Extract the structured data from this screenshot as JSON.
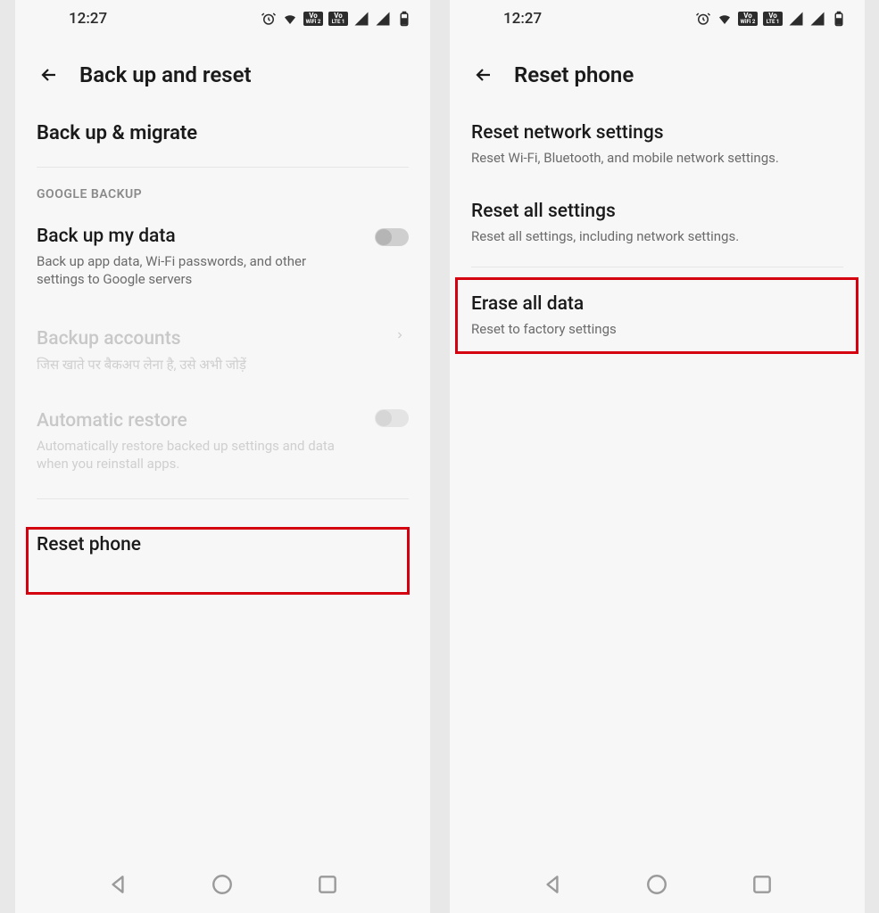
{
  "status": {
    "time": "12:27",
    "wifi_badge_top": "Vo",
    "wifi_badge_bot": "WiFi 2",
    "lte_badge_top": "Vo",
    "lte_badge_bot": "LTE 1"
  },
  "left": {
    "title": "Back up and reset",
    "backup_migrate": "Back up & migrate",
    "google_backup_label": "GOOGLE BACKUP",
    "backup_my_data": {
      "title": "Back up my data",
      "sub": "Back up app data, Wi-Fi passwords, and other settings to Google servers"
    },
    "backup_accounts": {
      "title": "Backup accounts",
      "sub": "जिस खाते पर बैकअप लेना है, उसे अभी जोड़ें"
    },
    "automatic_restore": {
      "title": "Automatic restore",
      "sub": "Automatically restore backed up settings and data when you reinstall apps."
    },
    "reset_phone": "Reset phone"
  },
  "right": {
    "title": "Reset phone",
    "reset_network": {
      "title": "Reset network settings",
      "sub": "Reset Wi-Fi, Bluetooth, and mobile network settings."
    },
    "reset_all": {
      "title": "Reset all settings",
      "sub": "Reset all settings, including network settings."
    },
    "erase_all": {
      "title": "Erase all data",
      "sub": "Reset to factory settings"
    }
  }
}
